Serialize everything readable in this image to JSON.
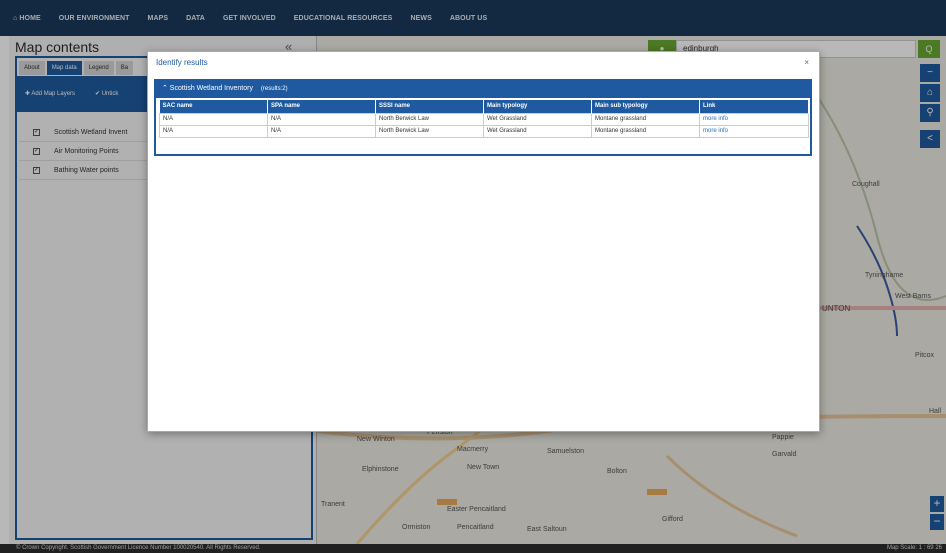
{
  "nav": {
    "items": [
      "⌂ HOME",
      "OUR ENVIRONMENT",
      "MAPS",
      "DATA",
      "GET INVOLVED",
      "EDUCATIONAL RESOURCES",
      "NEWS",
      "ABOUT US"
    ]
  },
  "panel": {
    "title": "Map contents",
    "collapse": "«",
    "tabs": [
      "About",
      "Map data",
      "Legend",
      "Ba"
    ],
    "add_layers": "✚ Add Map Layers",
    "untick": "✔ Untick",
    "layers": [
      "Scottish Wetland Invent",
      "Air Monitoring Points",
      "Bathing Water points"
    ]
  },
  "search": {
    "value": "edinburgh",
    "go": "Q"
  },
  "map_controls": [
    "−",
    "⌂",
    "⚲",
    "<"
  ],
  "map_labels": [
    "Penston",
    "New Winton",
    "Macmerry",
    "Samuelston",
    "Elphinstone",
    "New Town",
    "Bolton",
    "Tranent",
    "Easter Pencaitland",
    "Ormiston",
    "Pencaitland",
    "East Saltoun",
    "Gifford",
    "Garvald",
    "Pappie",
    "Coughall",
    "Tyninghame",
    "West Barns",
    "UNTON",
    "Pitcox",
    "Hall"
  ],
  "modal": {
    "title": "Identify results",
    "close": "×",
    "section": "⌃ Scottish Wetland Inventory",
    "count": "(results:2)",
    "columns": [
      "SAC name",
      "SPA name",
      "SSSI name",
      "Main typology",
      "Main sub typology",
      "Link"
    ],
    "rows": [
      [
        "N/A",
        "N/A",
        "North Berwick Law",
        "Wet Grassland",
        "Montane grassland",
        "more info"
      ],
      [
        "N/A",
        "N/A",
        "North Berwick Law",
        "Wet Grassland",
        "Montane grassland",
        "more info"
      ]
    ]
  },
  "footer": {
    "copyright": "© Crown Copyright. Scottish Government Licence Number 100020540. All Rights Reserved.",
    "scale": "Map Scale: 1 : 69 26"
  },
  "colors": {
    "brand_blue": "#1f5aa0",
    "nav_dark": "#1b3a5a",
    "search_green": "#6aa832"
  }
}
